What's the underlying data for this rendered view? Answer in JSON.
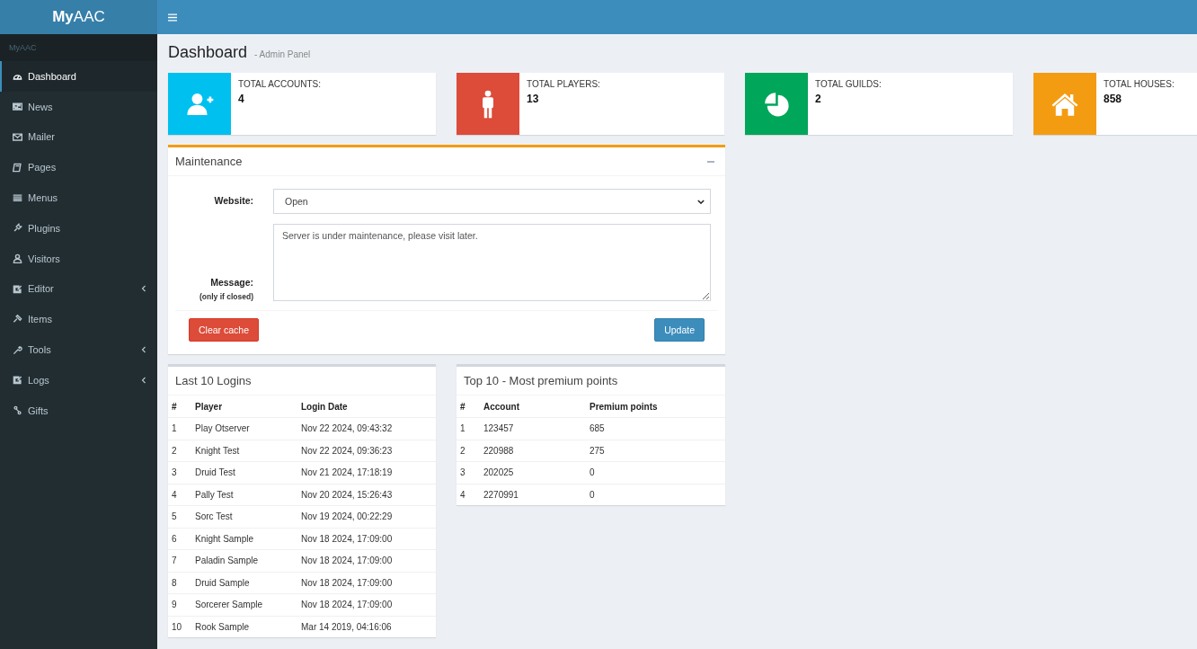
{
  "brand": "MyAAC",
  "sidebar": {
    "header": "MyAAC",
    "items": [
      {
        "label": "Dashboard",
        "selected": true,
        "expandable": false
      },
      {
        "label": "News",
        "selected": false,
        "expandable": false
      },
      {
        "label": "Mailer",
        "selected": false,
        "expandable": false
      },
      {
        "label": "Pages",
        "selected": false,
        "expandable": false
      },
      {
        "label": "Menus",
        "selected": false,
        "expandable": false
      },
      {
        "label": "Plugins",
        "selected": false,
        "expandable": false
      },
      {
        "label": "Visitors",
        "selected": false,
        "expandable": false
      },
      {
        "label": "Editor",
        "selected": false,
        "expandable": true
      },
      {
        "label": "Items",
        "selected": false,
        "expandable": false
      },
      {
        "label": "Tools",
        "selected": false,
        "expandable": true
      },
      {
        "label": "Logs",
        "selected": false,
        "expandable": true
      },
      {
        "label": "Gifts",
        "selected": false,
        "expandable": false
      }
    ]
  },
  "page": {
    "title": "Dashboard",
    "subtitle": "- Admin Panel"
  },
  "stats": [
    {
      "label": "TOTAL ACCOUNTS:",
      "value": "4",
      "color": "#00c0ef"
    },
    {
      "label": "TOTAL PLAYERS:",
      "value": "13",
      "color": "#dd4b39"
    },
    {
      "label": "TOTAL GUILDS:",
      "value": "2",
      "color": "#00a65a"
    },
    {
      "label": "TOTAL HOUSES:",
      "value": "858",
      "color": "#f39c12"
    }
  ],
  "maintenance": {
    "title": "Maintenance",
    "website_label": "Website:",
    "website_value": "Open",
    "message_label": "Message:",
    "message_hint": "(only if closed)",
    "message_value": "Server is under maintenance, please visit later.",
    "clear_button": "Clear cache",
    "update_button": "Update"
  },
  "tables": [
    {
      "title": "Last 10 Logins",
      "columns": [
        "#",
        "Player",
        "Login Date"
      ],
      "rows": [
        [
          "1",
          "Play Otserver",
          "Nov 22 2024, 09:43:32"
        ],
        [
          "2",
          "Knight Test",
          "Nov 22 2024, 09:36:23"
        ],
        [
          "3",
          "Druid Test",
          "Nov 21 2024, 17:18:19"
        ],
        [
          "4",
          "Pally Test",
          "Nov 20 2024, 15:26:43"
        ],
        [
          "5",
          "Sorc Test",
          "Nov 19 2024, 00:22:29"
        ],
        [
          "6",
          "Knight Sample",
          "Nov 18 2024, 17:09:00"
        ],
        [
          "7",
          "Paladin Sample",
          "Nov 18 2024, 17:09:00"
        ],
        [
          "8",
          "Druid Sample",
          "Nov 18 2024, 17:09:00"
        ],
        [
          "9",
          "Sorcerer Sample",
          "Nov 18 2024, 17:09:00"
        ],
        [
          "10",
          "Rook Sample",
          "Mar 14 2019, 04:16:06"
        ]
      ]
    },
    {
      "title": "Top 10 - Most premium points",
      "columns": [
        "#",
        "Account",
        "Premium points"
      ],
      "rows": [
        [
          "1",
          "123457",
          "685"
        ],
        [
          "2",
          "220988",
          "275"
        ],
        [
          "3",
          "202025",
          "0"
        ],
        [
          "4",
          "2270991",
          "0"
        ]
      ]
    }
  ]
}
